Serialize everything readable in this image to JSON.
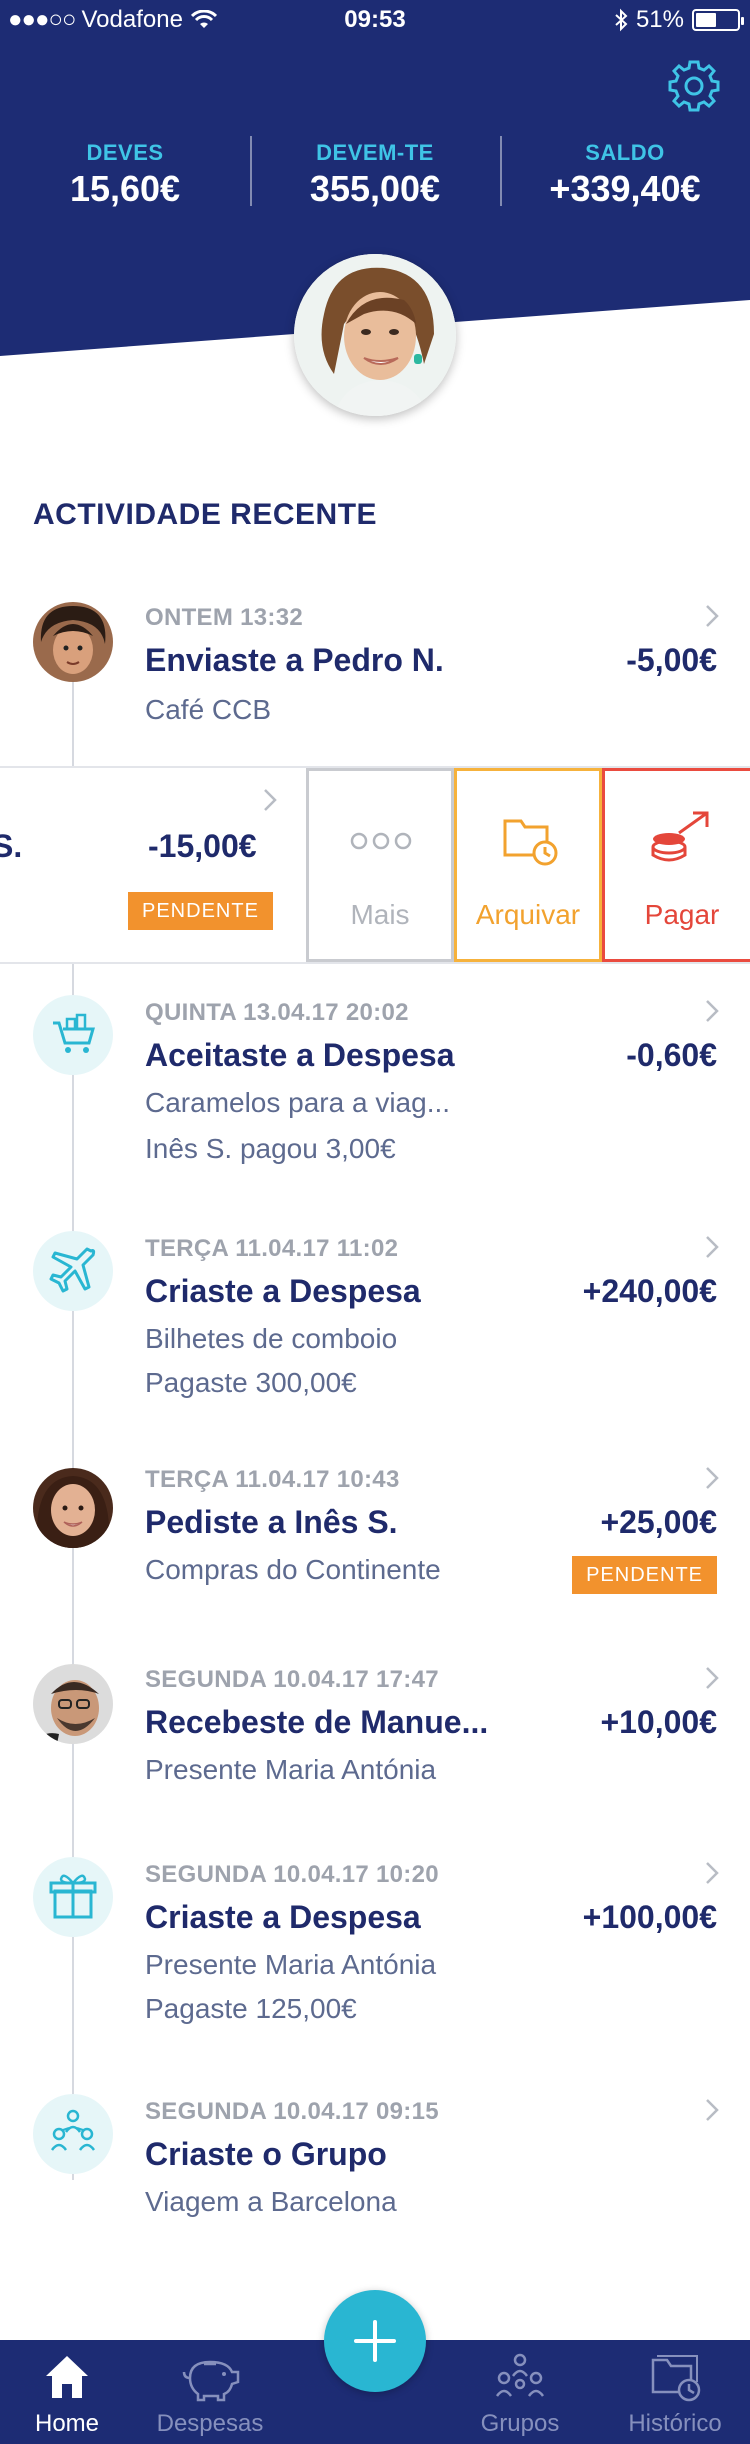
{
  "status_bar": {
    "signal": "●●●○○",
    "carrier": "Vodafone",
    "time": "09:53",
    "battery": "51%",
    "battery_level": 0.51
  },
  "summary": [
    {
      "label": "DEVES",
      "value": "15,60€"
    },
    {
      "label": "DEVEM-TE",
      "value": "355,00€"
    },
    {
      "label": "SALDO",
      "value": "+339,40€"
    }
  ],
  "section_title": "ACTIVIDADE RECENTE",
  "activity": [
    {
      "timestamp": "ONTEM 13:32",
      "title": "Enviaste a Pedro N.",
      "subtitle": "Café CCB",
      "amount": "-5,00€",
      "icon": "avatar-pedro"
    },
    {
      "timestamp": "QUINTA 13.04.17 20:02",
      "title": "Aceitaste a Despesa",
      "subtitle": "Caramelos para a viag...",
      "detail": "Inês S. pagou 3,00€",
      "amount": "-0,60€",
      "icon": "shopping-cart-icon"
    },
    {
      "timestamp": "TERÇA 11.04.17 11:02",
      "title": "Criaste a Despesa",
      "subtitle": "Bilhetes de comboio",
      "detail": "Pagaste 300,00€",
      "amount": "+240,00€",
      "icon": "airplane-icon"
    },
    {
      "timestamp": "TERÇA 11.04.17 10:43",
      "title": "Pediste a Inês S.",
      "subtitle": "Compras do Continente",
      "amount": "+25,00€",
      "badge": "PENDENTE",
      "icon": "avatar-ines"
    },
    {
      "timestamp": "SEGUNDA 10.04.17 17:47",
      "title": "Recebeste de Manue...",
      "subtitle": "Presente Maria Antónia",
      "amount": "+10,00€",
      "icon": "avatar-manuel"
    },
    {
      "timestamp": "SEGUNDA 10.04.17 10:20",
      "title": "Criaste a Despesa",
      "subtitle": "Presente Maria Antónia",
      "detail": "Pagaste 125,00€",
      "amount": "+100,00€",
      "icon": "gift-icon"
    },
    {
      "timestamp": "SEGUNDA 10.04.17 09:15",
      "title": "Criaste o Grupo",
      "subtitle": "Viagem a Barcelona",
      "icon": "group-icon"
    }
  ],
  "swiped_row": {
    "truncated_title": "S.",
    "amount": "-15,00€",
    "badge": "PENDENTE",
    "actions": [
      {
        "label": "Mais",
        "icon": "more-dots-icon",
        "color": "#c9cbd0"
      },
      {
        "label": "Arquivar",
        "icon": "archive-folder-icon",
        "color": "#f6b23c"
      },
      {
        "label": "Pagar",
        "icon": "pay-coins-icon",
        "color": "#ea4b3f"
      }
    ]
  },
  "tabbar": {
    "tabs": [
      {
        "label": "Home",
        "icon": "home-icon",
        "active": true
      },
      {
        "label": "Despesas",
        "icon": "piggy-bank-icon",
        "active": false
      },
      {
        "label": "Grupos",
        "icon": "groups-icon",
        "active": false
      },
      {
        "label": "Histórico",
        "icon": "history-folder-icon",
        "active": false
      }
    ],
    "fab_icon": "plus-icon"
  },
  "colors": {
    "header_bg": "#1d2c74",
    "accent": "#3fc4e6",
    "pending": "#f2922d",
    "fab": "#29b6d2"
  }
}
